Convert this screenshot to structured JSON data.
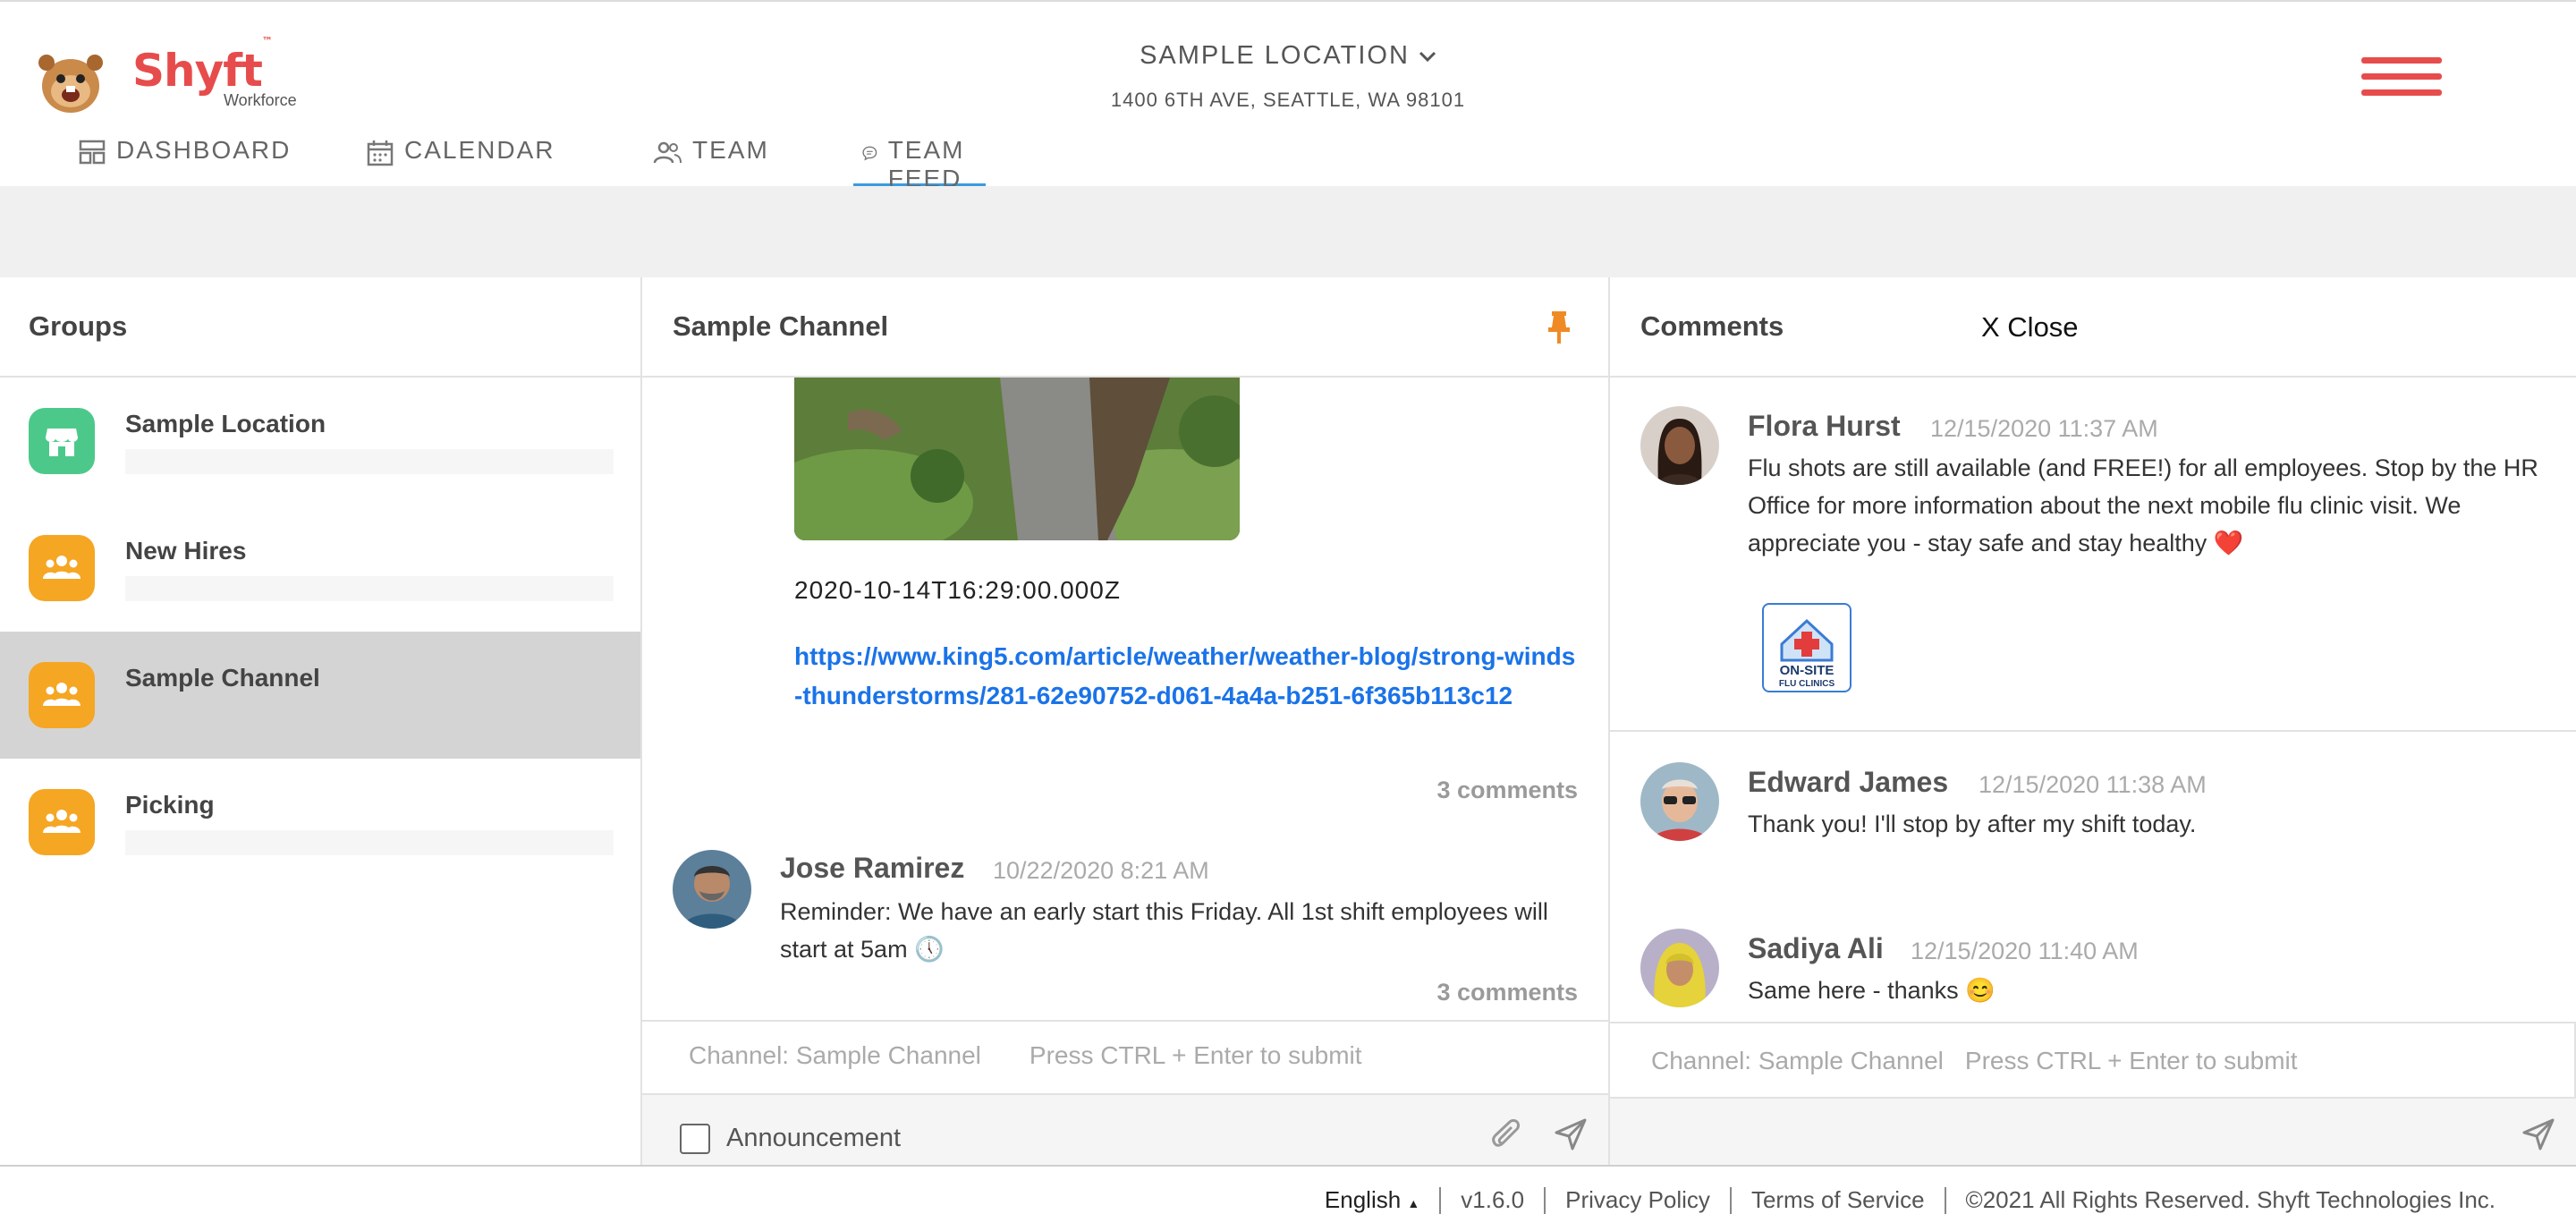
{
  "brand": {
    "name": "Shyft",
    "trademark": "™",
    "sub": "Workforce"
  },
  "location": {
    "name": "SAMPLE LOCATION",
    "address": "1400 6TH AVE, SEATTLE, WA 98101"
  },
  "nav": [
    {
      "label": "DASHBOARD",
      "icon": "dashboard-icon"
    },
    {
      "label": "CALENDAR",
      "icon": "calendar-icon"
    },
    {
      "label": "TEAM",
      "icon": "team-icon"
    },
    {
      "label": "TEAM FEED",
      "icon": "chat-bubble-icon",
      "active": true
    }
  ],
  "groups": {
    "title": "Groups",
    "items": [
      {
        "name": "Sample Location",
        "icon": "store-icon",
        "color": "#4cc98a"
      },
      {
        "name": "New Hires",
        "icon": "people-icon",
        "color": "#f5a623"
      },
      {
        "name": "Sample Channel",
        "icon": "people-icon",
        "color": "#f5a623",
        "selected": true
      },
      {
        "name": "Picking",
        "icon": "people-icon",
        "color": "#f5a623"
      }
    ]
  },
  "channel": {
    "title": "Sample Channel",
    "post1": {
      "timestamp": "2020-10-14T16:29:00.000Z",
      "link": "https://www.king5.com/article/weather/weather-blog/strong-winds-thunderstorms/281-62e90752-d061-4a4a-b251-6f365b113c12",
      "comments": "3 comments"
    },
    "post2": {
      "author": "Jose Ramirez",
      "date": "10/22/2020 8:21 AM",
      "message": "Reminder: We have an early start this Friday. All 1st shift employees will start at 5am 🕔",
      "comments": "3 comments"
    },
    "composer": {
      "channel_label": "Channel: Sample Channel",
      "hint": "Press CTRL + Enter to submit"
    },
    "announcement_label": "Announcement"
  },
  "comments": {
    "title": "Comments",
    "close_label": "X Close",
    "items": [
      {
        "author": "Flora Hurst",
        "date": "12/15/2020 11:37 AM",
        "message": "Flu shots are still available (and FREE!) for all employees. Stop by the HR Office for more information about the next mobile flu clinic visit. We appreciate you - stay safe and stay healthy ❤️",
        "badge_line1": "ON-SITE",
        "badge_line2": "FLU CLINICS"
      },
      {
        "author": "Edward James",
        "date": "12/15/2020 11:38 AM",
        "message": "Thank you! I'll stop by after my shift today."
      },
      {
        "author": "Sadiya Ali",
        "date": "12/15/2020 11:40 AM",
        "message": "Same here - thanks 😊"
      }
    ],
    "composer": {
      "channel_label": "Channel:  Sample Channel",
      "hint": "Press CTRL + Enter to submit"
    }
  },
  "footer": {
    "language": "English",
    "version": "v1.6.0",
    "privacy": "Privacy Policy",
    "terms": "Terms of Service",
    "copyright": "©2021 All Rights Reserved. Shyft Technologies Inc."
  },
  "colors": {
    "brand": "#e74c4c",
    "accent": "#3a9be0",
    "link": "#1a73e8",
    "pin": "#f08a24"
  }
}
